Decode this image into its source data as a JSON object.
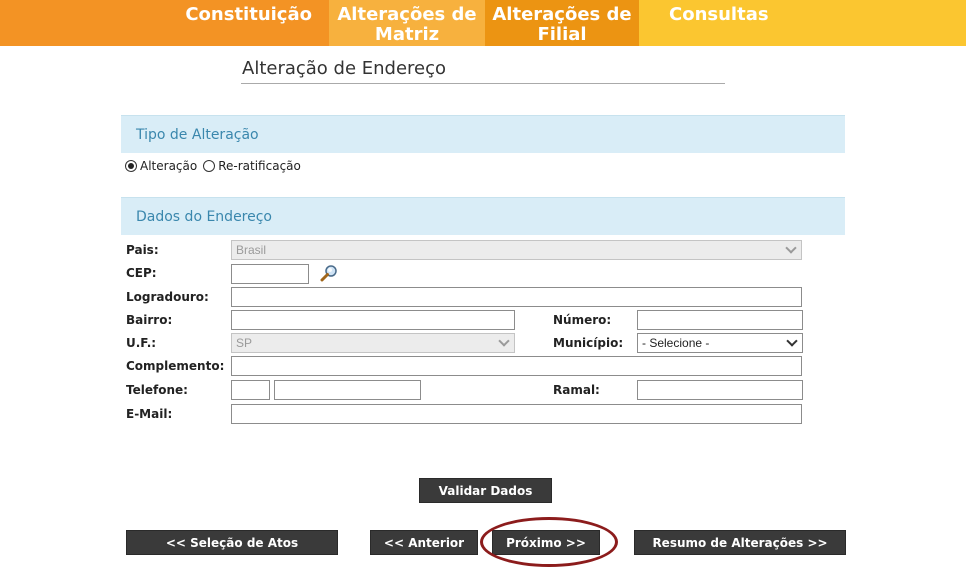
{
  "nav": {
    "tabs": [
      {
        "label": "Constituição"
      },
      {
        "label": "Alterações de Matriz"
      },
      {
        "label": "Alterações de Filial"
      },
      {
        "label": "Consultas"
      }
    ]
  },
  "page": {
    "title": "Alteração de Endereço"
  },
  "tipo": {
    "header": "Tipo de Alteração",
    "options": [
      {
        "label": "Alteração",
        "checked": true
      },
      {
        "label": "Re-ratificação",
        "checked": false
      }
    ]
  },
  "dados": {
    "header": "Dados do Endereço",
    "labels": {
      "pais": "Pais:",
      "cep": "CEP:",
      "logradouro": "Logradouro:",
      "bairro": "Bairro:",
      "numero": "Número:",
      "uf": "U.F.:",
      "municipio": "Município:",
      "complemento": "Complemento:",
      "telefone": "Telefone:",
      "ramal": "Ramal:",
      "email": "E-Mail:"
    },
    "values": {
      "pais": "Brasil",
      "cep": "",
      "logradouro": "",
      "bairro": "",
      "numero": "",
      "uf": "SP",
      "municipio": "- Selecione -",
      "complemento": "",
      "telefone_ddd": "",
      "telefone_numero": "",
      "ramal": "",
      "email": ""
    }
  },
  "buttons": {
    "validar": "Validar Dados",
    "selecao": "<< Seleção de Atos",
    "anterior": "<< Anterior",
    "proximo": "Próximo >>",
    "resumo": "Resumo de Alterações >>"
  },
  "colors": {
    "nav_constituicao": "#f39324",
    "nav_matriz": "#f7b13e",
    "nav_filial": "#ec9412",
    "nav_consultas": "#fbc630",
    "section_bg": "#d9edf7",
    "section_text": "#3a87ad",
    "button_bg": "#3a3a3a",
    "highlight": "#8c1c1c"
  },
  "icons": {
    "cep_search": "magnifier-icon"
  }
}
